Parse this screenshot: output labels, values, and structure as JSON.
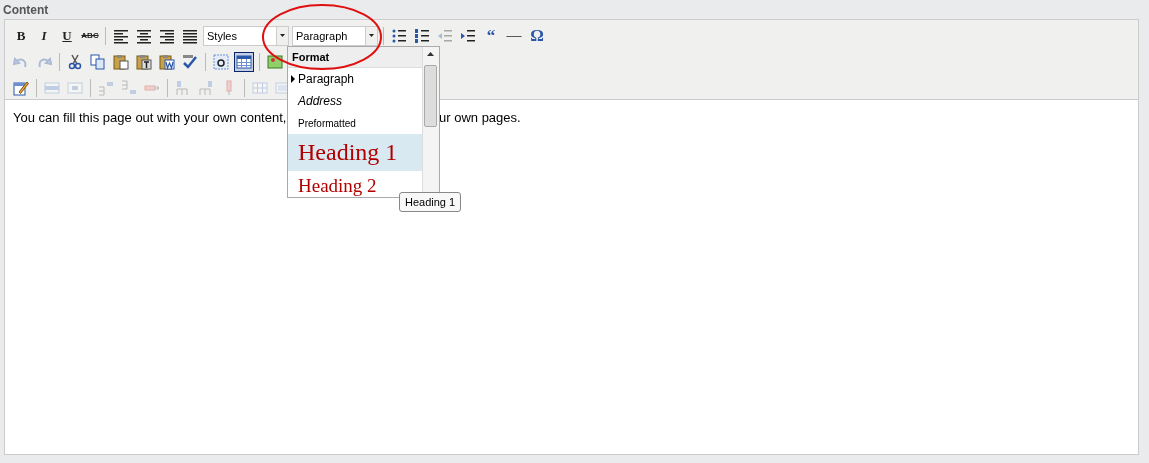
{
  "section_label": "Content",
  "toolbar": {
    "rows": [
      [
        {
          "kind": "text",
          "label": "B"
        },
        {
          "kind": "text",
          "label": "I"
        },
        {
          "kind": "text",
          "label": "U"
        },
        {
          "kind": "text",
          "label": "ABC"
        },
        {
          "kind": "separator"
        },
        {
          "kind": "icon",
          "disabled": false,
          "selected": false
        },
        {
          "kind": "icon",
          "disabled": false,
          "selected": false
        },
        {
          "kind": "icon",
          "disabled": false,
          "selected": false
        },
        {
          "kind": "icon",
          "disabled": false,
          "selected": false
        },
        {
          "kind": "combo",
          "value": "Styles"
        },
        {
          "kind": "combo",
          "value": "Paragraph"
        },
        {
          "kind": "separator"
        },
        {
          "kind": "icon",
          "disabled": false,
          "selected": false
        },
        {
          "kind": "icon",
          "disabled": false,
          "selected": false
        },
        {
          "kind": "icon",
          "disabled": true,
          "selected": false
        },
        {
          "kind": "icon",
          "disabled": false,
          "selected": false
        },
        {
          "kind": "text",
          "label": "“"
        },
        {
          "kind": "text",
          "label": "—"
        },
        {
          "kind": "text",
          "label": "Ω"
        }
      ],
      [
        {
          "kind": "icon",
          "disabled": true,
          "selected": false
        },
        {
          "kind": "icon",
          "disabled": true,
          "selected": false
        },
        {
          "kind": "separator"
        },
        {
          "kind": "icon",
          "disabled": false,
          "selected": false
        },
        {
          "kind": "icon",
          "disabled": false,
          "selected": false
        },
        {
          "kind": "icon",
          "disabled": false,
          "selected": false
        },
        {
          "kind": "icon",
          "disabled": false,
          "selected": false
        },
        {
          "kind": "icon",
          "disabled": false,
          "selected": false
        },
        {
          "kind": "icon",
          "disabled": false,
          "selected": false
        },
        {
          "kind": "separator"
        },
        {
          "kind": "icon",
          "disabled": false,
          "selected": false
        },
        {
          "kind": "icon",
          "disabled": false,
          "selected": true
        },
        {
          "kind": "separator"
        },
        {
          "kind": "icon",
          "disabled": false,
          "selected": false
        }
      ],
      [
        {
          "kind": "icon",
          "disabled": false,
          "selected": false
        },
        {
          "kind": "separator"
        },
        {
          "kind": "icon",
          "disabled": true,
          "selected": false
        },
        {
          "kind": "icon",
          "disabled": true,
          "selected": false
        },
        {
          "kind": "separator"
        },
        {
          "kind": "icon",
          "disabled": true,
          "selected": false
        },
        {
          "kind": "icon",
          "disabled": true,
          "selected": false
        },
        {
          "kind": "icon",
          "disabled": true,
          "selected": false
        },
        {
          "kind": "separator"
        },
        {
          "kind": "icon",
          "disabled": true,
          "selected": false
        },
        {
          "kind": "icon",
          "disabled": true,
          "selected": false
        },
        {
          "kind": "icon",
          "disabled": true,
          "selected": false
        },
        {
          "kind": "separator"
        },
        {
          "kind": "icon",
          "disabled": true,
          "selected": false
        },
        {
          "kind": "icon",
          "disabled": true,
          "selected": false
        }
      ]
    ]
  },
  "body": {
    "text_before": "You can fill this page out with your own content,",
    "text_after": "ur own pages."
  },
  "format_menu": {
    "header": "Format",
    "items": [
      {
        "label": "Paragraph",
        "kind": "paragraph",
        "current": true,
        "highlighted": false
      },
      {
        "label": "Address",
        "kind": "address",
        "current": false,
        "highlighted": false
      },
      {
        "label": "Preformatted",
        "kind": "pre",
        "current": false,
        "highlighted": false
      },
      {
        "label": "Heading 1",
        "kind": "h1",
        "current": false,
        "highlighted": true
      },
      {
        "label": "Heading 2",
        "kind": "h2",
        "current": false,
        "highlighted": false
      }
    ]
  },
  "tooltip": {
    "text": "Heading 1"
  }
}
